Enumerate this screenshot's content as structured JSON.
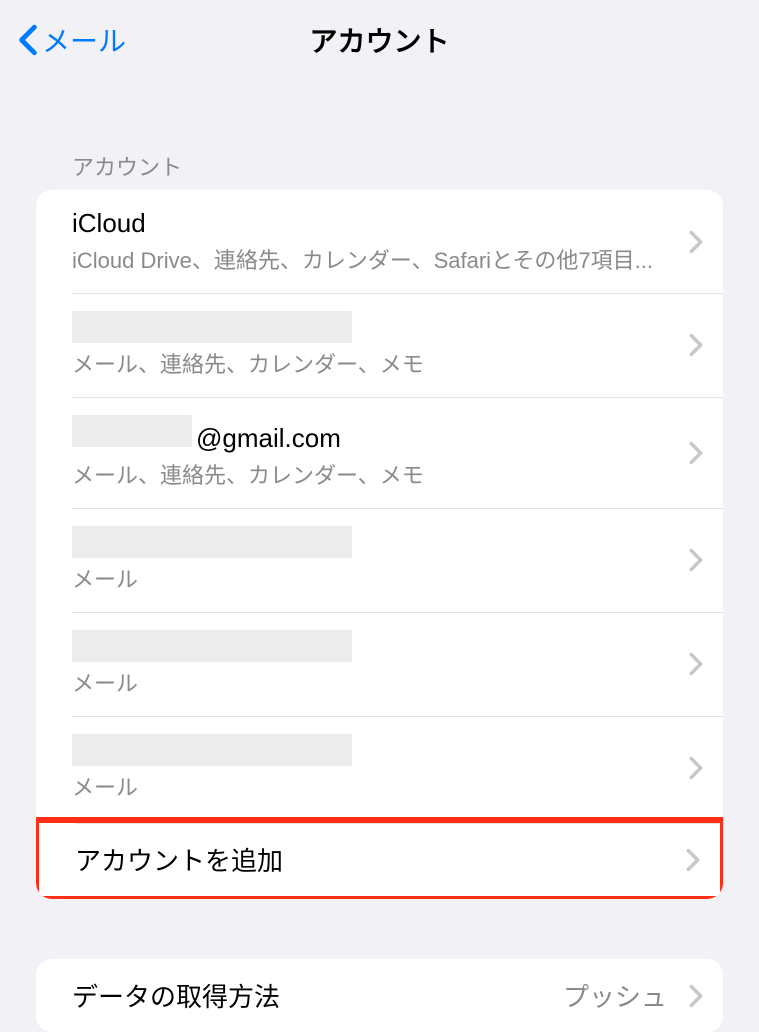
{
  "nav": {
    "back_label": "メール",
    "title": "アカウント"
  },
  "section_header": "アカウント",
  "accounts": [
    {
      "title": "iCloud",
      "subtitle": "iCloud Drive、連絡先、カレンダー、Safariとその他7項目...",
      "redacted_title": false,
      "title_suffix": ""
    },
    {
      "title": "",
      "subtitle": "メール、連絡先、カレンダー、メモ",
      "redacted_title": true,
      "title_suffix": ""
    },
    {
      "title": "",
      "subtitle": "メール、連絡先、カレンダー、メモ",
      "redacted_title": true,
      "title_suffix": "@gmail.com"
    },
    {
      "title": "",
      "subtitle": "メール",
      "redacted_title": true,
      "title_suffix": ""
    },
    {
      "title": "",
      "subtitle": "メール",
      "redacted_title": true,
      "title_suffix": ""
    },
    {
      "title": "",
      "subtitle": "メール",
      "redacted_title": true,
      "title_suffix": ""
    }
  ],
  "add_account_label": "アカウントを追加",
  "fetch": {
    "label": "データの取得方法",
    "value": "プッシュ"
  }
}
